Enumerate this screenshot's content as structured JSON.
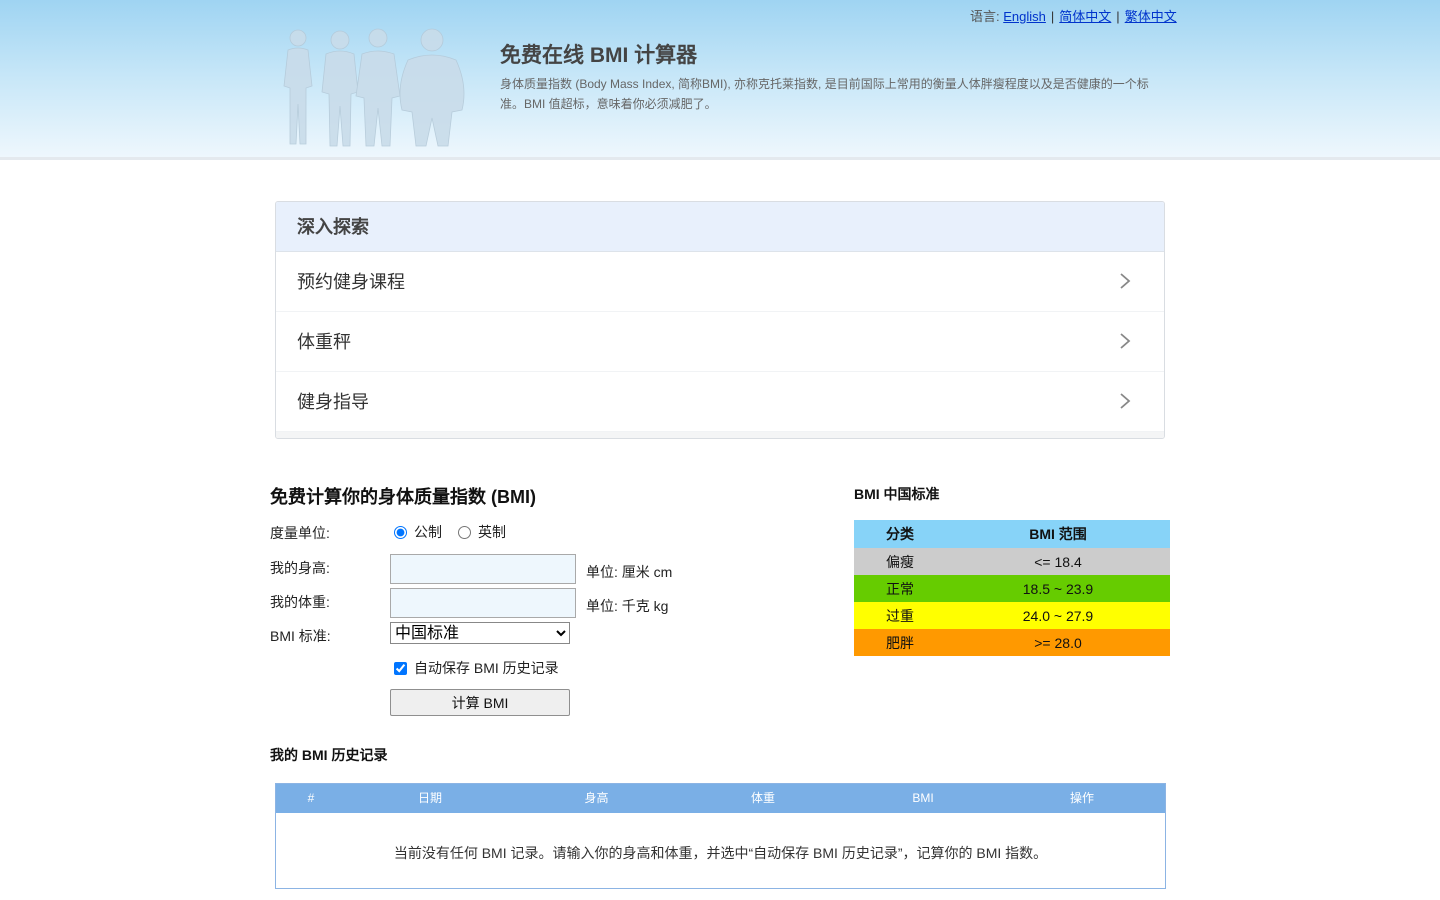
{
  "header": {
    "lang_label": "语言:",
    "languages": [
      "English",
      "简体中文",
      "繁体中文"
    ],
    "title": "免费在线 BMI 计算器",
    "description": "身体质量指数 (Body Mass Index, 简称BMI), 亦称克托莱指数, 是目前国际上常用的衡量人体胖瘦程度以及是否健康的一个标准。BMI 值超标，意味着你必须减肥了。"
  },
  "explore": {
    "heading": "深入探索",
    "items": [
      "预约健身课程",
      "体重秤",
      "健身指导"
    ]
  },
  "form": {
    "title": "免费计算你的身体质量指数 (BMI)",
    "unit_label": "度量单位:",
    "unit_options": [
      "公制",
      "英制"
    ],
    "height_label": "我的身高:",
    "height_value": "",
    "height_unit": "单位: 厘米 cm",
    "weight_label": "我的体重:",
    "weight_value": "",
    "weight_unit": "单位: 千克 kg",
    "standard_label": "BMI 标准:",
    "standard_selected": "中国标准",
    "autosave_label": "自动保存 BMI 历史记录",
    "calc_button": "计算 BMI"
  },
  "standard": {
    "title": "BMI 中国标准",
    "headers": [
      "分类",
      "BMI 范围"
    ],
    "rows": [
      {
        "category": "偏瘦",
        "range": "<= 18.4",
        "color": "#cccccc"
      },
      {
        "category": "正常",
        "range": "18.5 ~ 23.9",
        "color": "#66cc00"
      },
      {
        "category": "过重",
        "range": "24.0 ~ 27.9",
        "color": "#ffff00"
      },
      {
        "category": "肥胖",
        "range": ">= 28.0",
        "color": "#ff9900"
      }
    ]
  },
  "history": {
    "title": "我的 BMI 历史记录",
    "columns": [
      "#",
      "日期",
      "身高",
      "体重",
      "BMI",
      "操作"
    ],
    "empty_message": "当前没有任何 BMI 记录。请输入你的身高和体重，并选中“自动保存 BMI 历史记录”，记算你的 BMI 指数。"
  }
}
